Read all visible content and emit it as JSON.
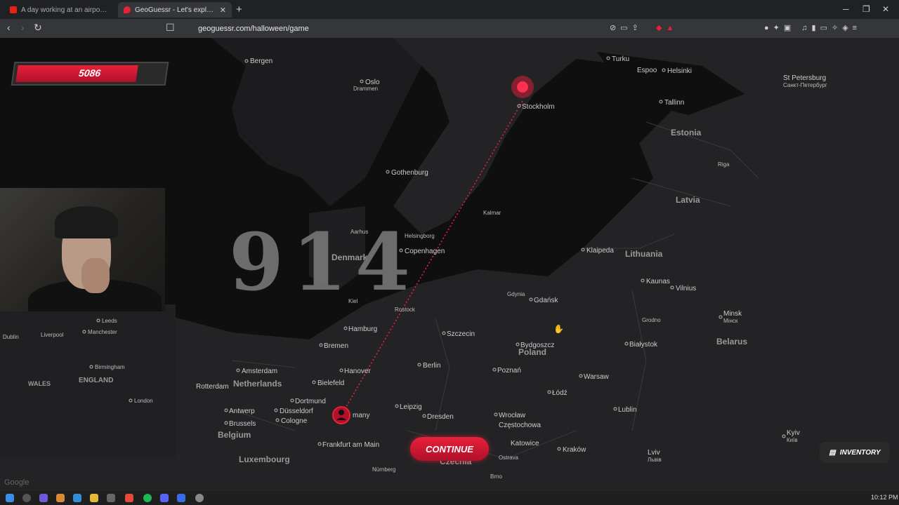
{
  "browser": {
    "tabs": [
      {
        "label": "A day working at an airport: what ha",
        "active": false
      },
      {
        "label": "GeoGuessr - Let's explore the",
        "active": true
      }
    ],
    "url": "geoguessr.com/halloween/game"
  },
  "game": {
    "score": "5086",
    "score_fill_fraction": 0.82,
    "distance_number": "914",
    "continue_label": "CONTINUE",
    "inventory_label": "INVENTORY",
    "map_attribution": "Google"
  },
  "map": {
    "countries": [
      "Estonia",
      "Latvia",
      "Lithuania",
      "Denmark",
      "Netherlands",
      "Belgium",
      "Luxembourg",
      "Poland",
      "Belarus",
      "ENGLAND",
      "WALES",
      "Czechia"
    ],
    "cities": [
      "Bergen",
      "Oslo",
      "Drammen",
      "Stockholm",
      "Turku",
      "Helsinki",
      "Espoo",
      "Tallinn",
      "St Petersburg",
      "Санкт-Петербург",
      "Gothenburg",
      "Copenhagen",
      "Helsingborg",
      "Kalmar",
      "Riga",
      "Klaipeda",
      "Kaunas",
      "Vilnius",
      "Gdańsk",
      "Gdynia",
      "Szczecin",
      "Berlin",
      "Hamburg",
      "Bremen",
      "Hanover",
      "Bielefeld",
      "Dortmund",
      "Düsseldorf",
      "Cologne",
      "Amsterdam",
      "Rotterdam",
      "Antwerp",
      "Brussels",
      "Frankfurt am Main",
      "Leipzig",
      "Dresden",
      "Poznań",
      "Bydgoszcz",
      "Warsaw",
      "Łódź",
      "Lublin",
      "Wrocław",
      "Kraków",
      "Katowice",
      "Częstochowa",
      "Białystok",
      "Minsk",
      "Мінск",
      "Grodno",
      "Kyiv",
      "Київ",
      "Leeds",
      "Manchester",
      "Liverpool",
      "Birmingham",
      "London",
      "Dublin",
      "Aarhus",
      "Kiel",
      "Rostock",
      "Nürnberg",
      "Lviv",
      "Львів",
      "Brno",
      "Ostrava"
    ],
    "tooltip_partial": "many"
  },
  "taskbar": {
    "time": "10:12 PM"
  }
}
